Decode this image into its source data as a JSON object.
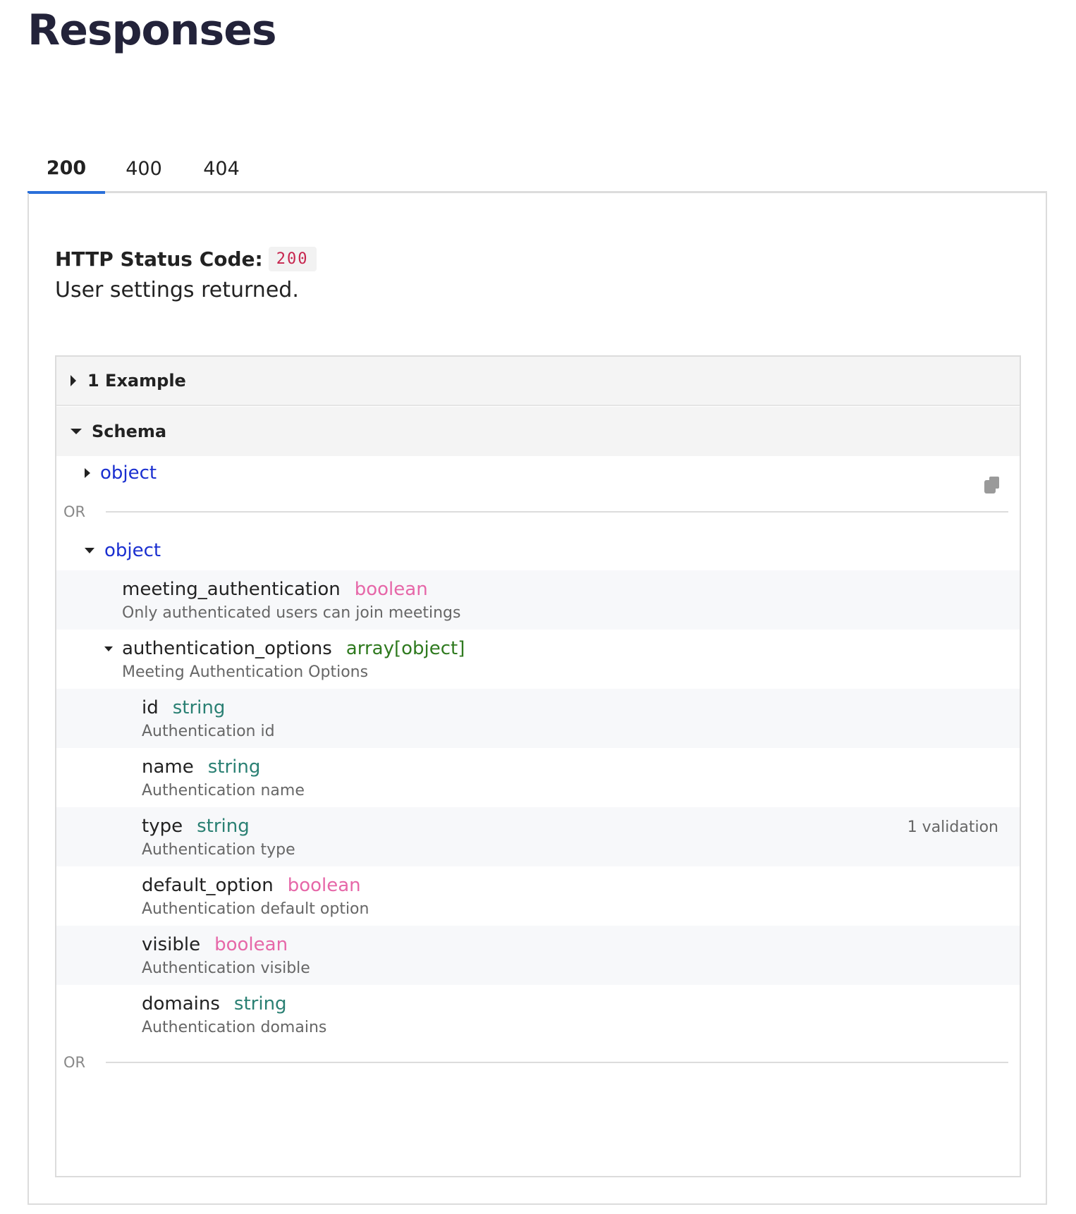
{
  "page": {
    "title": "Responses"
  },
  "tabs": [
    {
      "label": "200",
      "active": true
    },
    {
      "label": "400",
      "active": false
    },
    {
      "label": "404",
      "active": false
    }
  ],
  "response": {
    "status_label": "HTTP Status Code:",
    "status_code": "200",
    "description": "User settings returned."
  },
  "example": {
    "label": "1 Example"
  },
  "schema": {
    "label": "Schema",
    "or_label": "OR",
    "object1": {
      "label": "object",
      "expanded": false
    },
    "object2": {
      "label": "object",
      "expanded": true,
      "properties": [
        {
          "name": "meeting_authentication",
          "type": "boolean",
          "description": "Only authenticated users can join meetings"
        },
        {
          "name": "authentication_options",
          "type": "array[object]",
          "description": "Meeting Authentication Options"
        }
      ],
      "nested": [
        {
          "name": "id",
          "type": "string",
          "description": "Authentication id"
        },
        {
          "name": "name",
          "type": "string",
          "description": "Authentication name"
        },
        {
          "name": "type",
          "type": "string",
          "description": "Authentication type",
          "validation": "1 validation"
        },
        {
          "name": "default_option",
          "type": "boolean",
          "description": "Authentication default option"
        },
        {
          "name": "visible",
          "type": "boolean",
          "description": "Authentication visible"
        },
        {
          "name": "domains",
          "type": "string",
          "description": "Authentication domains"
        }
      ]
    }
  },
  "colors": {
    "accent_tab": "#2a6fd9",
    "object_link": "#1a2fd0",
    "type_boolean": "#e667a8",
    "type_string": "#2a8073",
    "type_array": "#2f7a1f",
    "status_code": "#c7254e"
  },
  "icons": {
    "copy": "copy-icon"
  }
}
